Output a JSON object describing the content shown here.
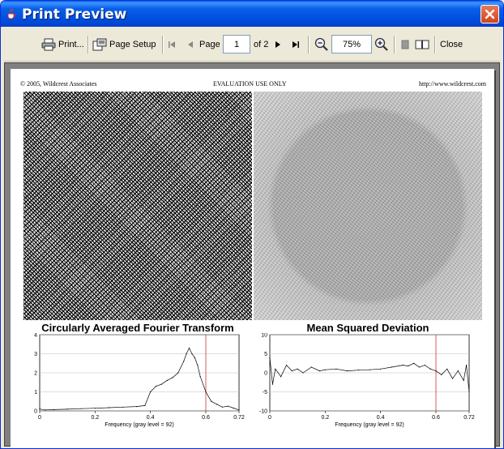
{
  "window": {
    "title": "Print Preview"
  },
  "toolbar": {
    "print_label": "Print...",
    "page_setup_label": "Page Setup",
    "page_label": "Page",
    "page_value": "1",
    "of_label": "of 2",
    "zoom_value": "75%",
    "close_label": "Close"
  },
  "page_header": {
    "left": "© 2005, Wildcrest Associates",
    "center": "EVALUATION USE ONLY",
    "right": "http://www.wildcrest.com"
  },
  "chart_data": [
    {
      "type": "line",
      "title": "Circularly Averaged Fourier Transform",
      "xlabel": "Frequency (gray level = 92)",
      "ylabel": "",
      "xlim": [
        0,
        0.72
      ],
      "ylim": [
        0,
        4
      ],
      "x_ticks": [
        "0",
        "0.2",
        "0.4",
        "0.6",
        "0.72"
      ],
      "y_ticks": [
        "0",
        "1",
        "2",
        "3",
        "4"
      ],
      "grid": true,
      "marker_x": 0.6,
      "marker_color": "#cc3333",
      "series": [
        {
          "x": [
            0,
            0.02,
            0.05,
            0.1,
            0.15,
            0.2,
            0.25,
            0.3,
            0.35,
            0.38,
            0.4,
            0.42,
            0.44,
            0.46,
            0.48,
            0.5,
            0.52,
            0.53,
            0.54,
            0.55,
            0.56,
            0.57,
            0.58,
            0.6,
            0.62,
            0.64,
            0.66,
            0.68,
            0.7,
            0.72
          ],
          "y": [
            0.1,
            0.05,
            0.07,
            0.09,
            0.12,
            0.14,
            0.17,
            0.2,
            0.23,
            0.28,
            1.0,
            1.3,
            1.4,
            1.6,
            1.75,
            2.0,
            2.6,
            3.0,
            3.3,
            3.0,
            2.8,
            2.4,
            1.8,
            1.0,
            0.5,
            0.35,
            0.2,
            0.25,
            0.15,
            0.05
          ]
        }
      ]
    },
    {
      "type": "line",
      "title": "Mean Squared Deviation",
      "xlabel": "Frequency (gray level = 92)",
      "ylabel": "",
      "xlim": [
        0,
        0.72
      ],
      "ylim": [
        -10,
        10
      ],
      "x_ticks": [
        "0",
        "0.2",
        "0.4",
        "0.6",
        "0.72"
      ],
      "y_ticks": [
        "-10",
        "-5",
        "0",
        "5",
        "10"
      ],
      "grid": true,
      "marker_x": 0.6,
      "marker_color": "#cc3333",
      "series": [
        {
          "x": [
            0,
            0.01,
            0.02,
            0.04,
            0.06,
            0.08,
            0.1,
            0.12,
            0.15,
            0.18,
            0.2,
            0.24,
            0.28,
            0.32,
            0.36,
            0.4,
            0.44,
            0.48,
            0.5,
            0.52,
            0.54,
            0.56,
            0.58,
            0.6,
            0.62,
            0.64,
            0.66,
            0.68,
            0.7,
            0.71,
            0.72
          ],
          "y": [
            4,
            -3,
            1,
            -1,
            2,
            0.5,
            1,
            0,
            1.5,
            0.5,
            0.8,
            1,
            0.5,
            0.7,
            0.8,
            1,
            1.5,
            2,
            1.8,
            2.5,
            1.5,
            2,
            1,
            0.5,
            -0.5,
            1,
            -1.5,
            0.5,
            -2,
            2,
            -5
          ]
        }
      ]
    }
  ]
}
